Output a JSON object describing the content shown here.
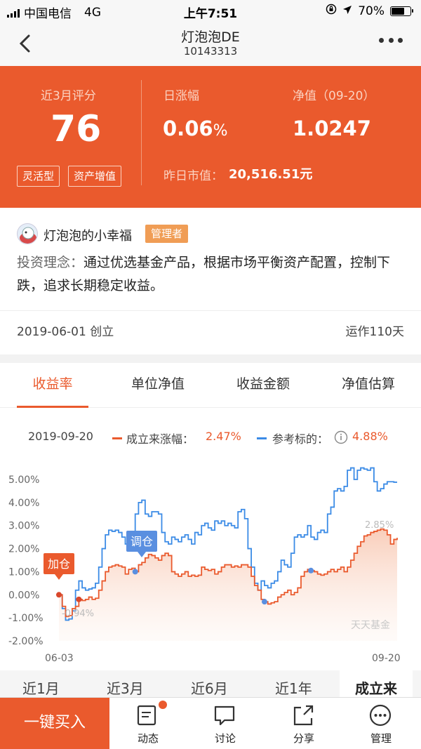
{
  "status_bar": {
    "carrier": "中国电信",
    "network": "4G",
    "time": "上午7:51",
    "battery": "70%",
    "battery_level": 0.7
  },
  "nav": {
    "title": "灯泡泡DE",
    "code": "10143313"
  },
  "hero": {
    "score_label": "近3月评分",
    "score": "76",
    "daily_label": "日涨幅",
    "daily_value": "0.06",
    "daily_unit": "%",
    "nav_label": "净值（09-20）",
    "nav_value": "1.0247",
    "tags": [
      "灵活型",
      "资产增值"
    ],
    "market_label": "昨日市值：",
    "market_value": "20,516.51元"
  },
  "manager": {
    "name": "灯泡泡的小幸福",
    "badge": "管理者",
    "philosophy_key": "投资理念：",
    "philosophy_text": "通过优选基金产品，根据市场平衡资产配置，控制下跌，追求长期稳定收益。",
    "founded": "2019-06-01 创立",
    "running": "运作110天"
  },
  "tabs": [
    "收益率",
    "单位净值",
    "收益金额",
    "净值估算"
  ],
  "legend": {
    "date": "2019-09-20",
    "series1_label": "成立来涨幅：",
    "series1_value": "2.47%",
    "series2_label": "参考标的：",
    "series2_value": "4.88%"
  },
  "chart_data": {
    "type": "line",
    "ylim": [
      -2.0,
      5.5
    ],
    "yticks": [
      "5.00%",
      "4.00%",
      "3.00%",
      "2.00%",
      "1.00%",
      "0.00%",
      "-1.00%",
      "-2.00%"
    ],
    "yvalues": [
      5,
      4,
      3,
      2,
      1,
      0,
      -1,
      -2
    ],
    "xlabels": [
      "06-03",
      "09-20"
    ],
    "annotations": {
      "buy": "加仓",
      "adjust": "调仓",
      "max_label": "2.85%",
      "min_label": "-0.94%",
      "watermark": "天天基金"
    },
    "series": [
      {
        "values": [
          0.0,
          -0.5,
          -0.94,
          -0.9,
          -0.6,
          -0.5,
          -0.2,
          -0.25,
          -0.2,
          -0.1,
          -0.2,
          -0.15,
          0.2,
          0.6,
          1.0,
          1.2,
          1.25,
          1.3,
          1.25,
          1.2,
          0.9,
          1.1,
          1.15,
          1.0,
          1.3,
          1.4,
          1.6,
          1.75,
          1.7,
          1.6,
          1.5,
          1.7,
          1.8,
          1.7,
          1.0,
          0.9,
          0.8,
          0.9,
          1.0,
          0.8,
          0.85,
          0.8,
          0.85,
          1.2,
          1.1,
          1.05,
          1.1,
          0.9,
          1.0,
          1.2,
          1.3,
          1.3,
          1.2,
          1.25,
          1.2,
          1.3,
          1.3,
          1.2,
          0.8,
          0.4,
          0.2,
          -0.2,
          -0.3,
          -0.4,
          -0.35,
          -0.3,
          -0.1,
          0.0,
          0.1,
          0.2,
          0.0,
          0.1,
          0.3,
          0.8,
          1.0,
          1.1,
          1.05,
          1.0,
          0.9,
          0.85,
          0.9,
          1.0,
          1.1,
          1.0,
          1.1,
          1.2,
          1.0,
          1.2,
          1.5,
          1.8,
          2.1,
          2.3,
          2.55,
          2.6,
          2.7,
          2.75,
          2.8,
          2.85,
          2.8,
          2.6,
          2.2,
          2.4,
          2.47
        ]
      },
      {
        "values": [
          0.0,
          -0.6,
          -1.1,
          -1.05,
          -0.7,
          0.2,
          0.6,
          0.3,
          0.2,
          0.25,
          0.3,
          0.5,
          1.2,
          2.0,
          2.6,
          2.8,
          2.75,
          2.8,
          2.7,
          2.5,
          2.2,
          2.7,
          2.6,
          3.5,
          4.0,
          4.1,
          3.5,
          3.4,
          3.6,
          3.6,
          3.5,
          2.7,
          2.3,
          2.2,
          2.5,
          2.4,
          2.3,
          2.5,
          2.6,
          2.4,
          2.2,
          2.7,
          2.6,
          3.0,
          3.1,
          2.9,
          2.8,
          3.2,
          3.1,
          3.2,
          3.0,
          3.1,
          3.0,
          2.9,
          3.6,
          3.7,
          3.3,
          2.0,
          1.2,
          0.5,
          0.2,
          0.6,
          0.4,
          0.3,
          0.5,
          0.6,
          1.0,
          1.5,
          1.3,
          1.2,
          1.8,
          2.5,
          2.6,
          2.5,
          2.6,
          3.0,
          2.5,
          2.4,
          2.7,
          2.8,
          2.7,
          3.5,
          3.8,
          4.5,
          4.6,
          4.5,
          4.7,
          5.4,
          5.5,
          5.0,
          5.4,
          5.5,
          5.45,
          5.4,
          5.5,
          4.9,
          4.5,
          4.6,
          4.8,
          4.9,
          4.9,
          4.88,
          4.88
        ]
      }
    ]
  },
  "periods": [
    "近1月",
    "近3月",
    "近6月",
    "近1年",
    "成立来"
  ],
  "bottom": {
    "buy": "一键买入",
    "items": [
      "动态",
      "讨论",
      "分享",
      "管理"
    ]
  },
  "colors": {
    "accent": "#ea5a2d",
    "blue": "#3b8be6"
  }
}
